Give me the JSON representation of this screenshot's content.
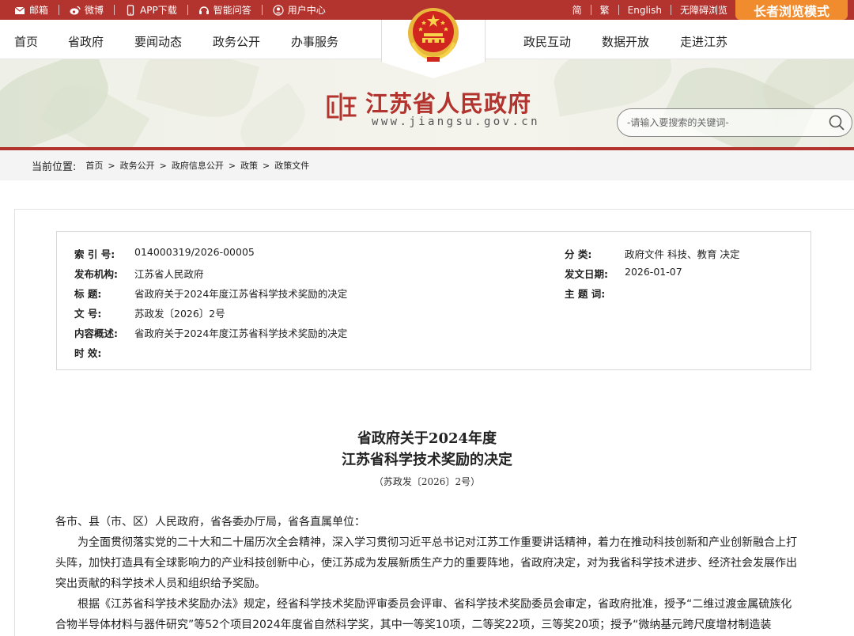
{
  "topbar": {
    "mail": "邮箱",
    "weibo": "微博",
    "app": "APP下载",
    "qa": "智能问答",
    "user": "用户中心",
    "simplified": "简",
    "traditional": "繁",
    "english": "English",
    "accessible": "无障碍浏览",
    "elder_mode": "长者浏览模式",
    "colors": {
      "bar": "#b3342f",
      "elder": "#f08c2e"
    }
  },
  "nav": {
    "left": [
      "首页",
      "省政府",
      "要闻动态",
      "政务公开",
      "办事服务"
    ],
    "right": [
      "政民互动",
      "数据开放",
      "走进江苏"
    ]
  },
  "brand": {
    "name": "江苏省人民政府",
    "url": "www.jiangsu.gov.cn"
  },
  "search": {
    "placeholder": "-请输入要搜索的关键词-"
  },
  "breadcrumb": {
    "lead": "当前位置:",
    "items": [
      "首页",
      "政务公开",
      "政府信息公开",
      "政策",
      "政策文件"
    ]
  },
  "meta": {
    "index_label": "索 引 号:",
    "index_value": "014000319/2026-00005",
    "org_label": "发布机构:",
    "org_value": "江苏省人民政府",
    "title_label": "标  题:",
    "title_value": "省政府关于2024年度江苏省科学技术奖励的决定",
    "docno_label": "文  号:",
    "docno_value": "苏政发〔2026〕2号",
    "summary_label": "内容概述:",
    "summary_value": "省政府关于2024年度江苏省科学技术奖励的决定",
    "validity_label": "时  效:",
    "category_label": "分  类:",
    "category_value": "政府文件 科技、教育 决定",
    "date_label": "发文日期:",
    "date_value": "2026-01-07",
    "keywords_label": "主 题 词:"
  },
  "doc": {
    "title_line1": "省政府关于2024年度",
    "title_line2": "江苏省科学技术奖励的决定",
    "doc_no": "（苏政发〔2026〕2号）",
    "para1": "各市、县（市、区）人民政府，省各委办厅局，省各直属单位：",
    "para2": "为全面贯彻落实党的二十大和二十届历次全会精神，深入学习贯彻习近平总书记对江苏工作重要讲话精神，着力在推动科技创新和产业创新融合上打头阵，加快打造具有全球影响力的产业科技创新中心，使江苏成为发展新质生产力的重要阵地，省政府决定，对为我省科学技术进步、经济社会发展作出突出贡献的科学技术人员和组织给予奖励。",
    "para3": "根据《江苏省科学技术奖励办法》规定，经省科学技术奖励评审委员会评审、省科学技术奖励委员会审定，省政府批准，授予“二维过渡金属硫族化合物半导体材料与器件研究”等52个项目2024年度省自然科学奖，其中一等奖10项，二等奖22项，三等奖20项；授予“微纳基元跨尺度增材制造装"
  }
}
